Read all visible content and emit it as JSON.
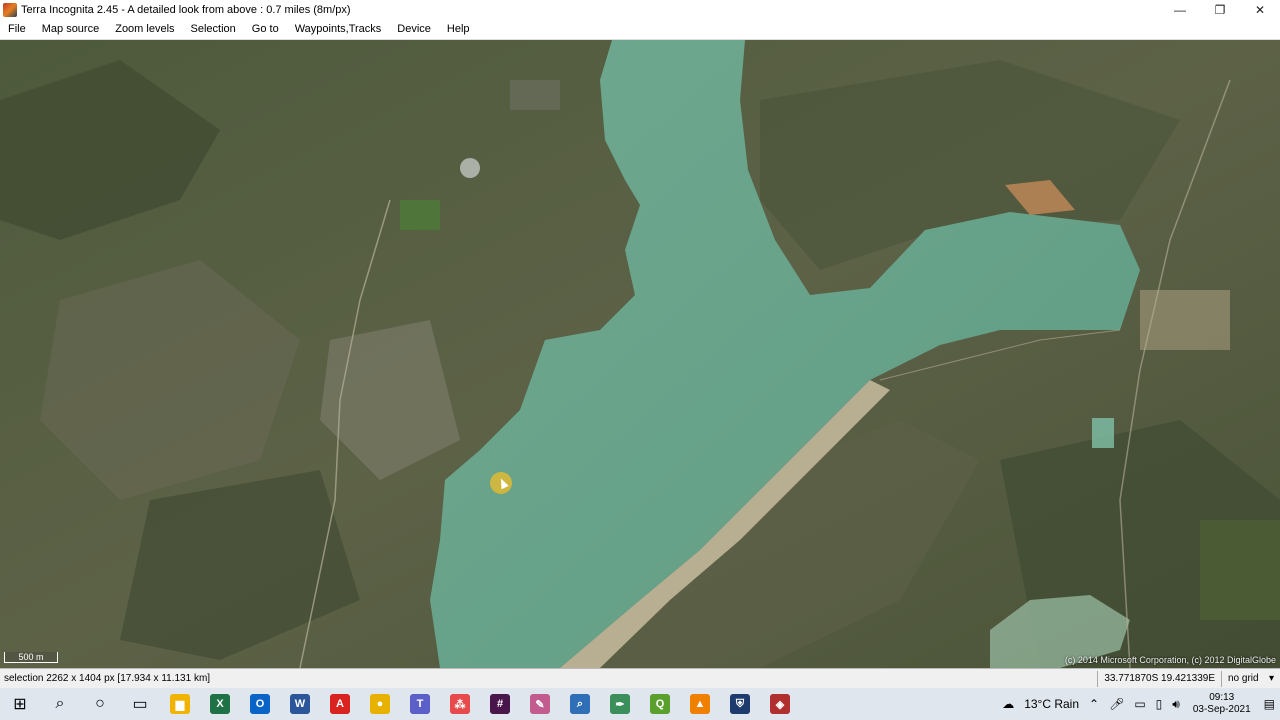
{
  "window": {
    "title": "Terra Incognita 2.45 - A detailed look from above : 0.7 miles (8m/px)",
    "minimize": "—",
    "maximize": "❐",
    "close": "✕"
  },
  "menu": [
    "File",
    "Map source",
    "Zoom levels",
    "Selection",
    "Go to",
    "Waypoints,Tracks",
    "Device",
    "Help"
  ],
  "map": {
    "scale_label": "500 m",
    "copyright": "(c) 2014 Microsoft Corporation, (c) 2012 DigitalGlobe"
  },
  "status": {
    "selection": "selection 2262 x 1404 px [17.934 x 11.131 km]",
    "coordinates": "33.771870S 19.421339E",
    "grid": "no grid"
  },
  "taskbar": {
    "apps": [
      {
        "name": "start-icon",
        "glyph": "⊞",
        "color": "#000000"
      },
      {
        "name": "search-icon",
        "glyph": "⌕",
        "color": "#000000"
      },
      {
        "name": "cortana-icon",
        "glyph": "○",
        "color": "#000000"
      },
      {
        "name": "task-view-icon",
        "glyph": "▭",
        "color": "#000000"
      },
      {
        "name": "file-explorer-icon",
        "glyph": "▆",
        "color": "#f0b400"
      },
      {
        "name": "excel-icon",
        "glyph": "X",
        "color": "#1e7145"
      },
      {
        "name": "outlook-icon",
        "glyph": "O",
        "color": "#0a64c8"
      },
      {
        "name": "word-icon",
        "glyph": "W",
        "color": "#2b579a"
      },
      {
        "name": "acrobat-icon",
        "glyph": "A",
        "color": "#d9231f"
      },
      {
        "name": "chrome-icon",
        "glyph": "●",
        "color": "#e8b100"
      },
      {
        "name": "teams-icon",
        "glyph": "T",
        "color": "#5b5fc7"
      },
      {
        "name": "dots-app-icon",
        "glyph": "⁂",
        "color": "#e64a4a"
      },
      {
        "name": "slack-icon",
        "glyph": "#",
        "color": "#4a154b"
      },
      {
        "name": "paint-icon",
        "glyph": "✎",
        "color": "#c25c8f"
      },
      {
        "name": "magnifier-app-icon",
        "glyph": "⌕",
        "color": "#2e6fb8"
      },
      {
        "name": "pen-app-icon",
        "glyph": "✒",
        "color": "#3b8f5a"
      },
      {
        "name": "qgis-icon",
        "glyph": "Q",
        "color": "#5aa02c"
      },
      {
        "name": "vlc-icon",
        "glyph": "▲",
        "color": "#f08000"
      },
      {
        "name": "shield-app-icon",
        "glyph": "⛨",
        "color": "#1d3b6f"
      },
      {
        "name": "terra-incognita-icon",
        "glyph": "◈",
        "color": "#b03030"
      }
    ],
    "weather": "13°C  Rain",
    "time": "09:13",
    "date": "03-Sep-2021"
  }
}
